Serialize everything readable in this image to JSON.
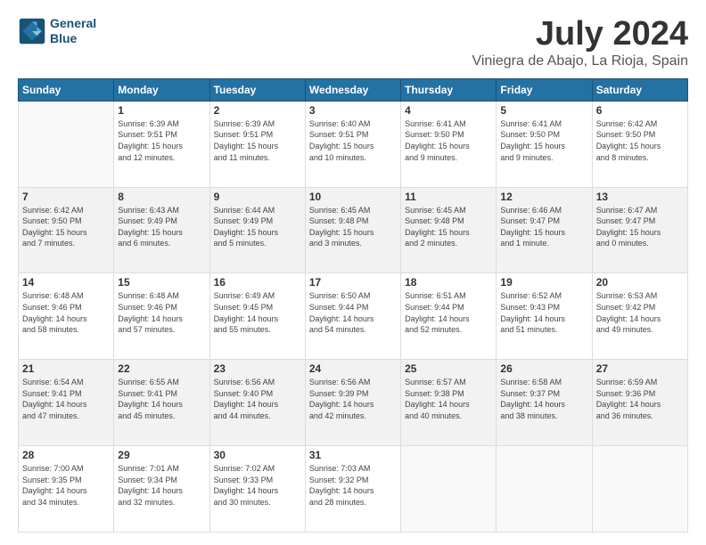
{
  "header": {
    "logo_line1": "General",
    "logo_line2": "Blue",
    "month": "July 2024",
    "location": "Viniegra de Abajo, La Rioja, Spain"
  },
  "weekdays": [
    "Sunday",
    "Monday",
    "Tuesday",
    "Wednesday",
    "Thursday",
    "Friday",
    "Saturday"
  ],
  "weeks": [
    [
      {
        "day": "",
        "info": ""
      },
      {
        "day": "1",
        "info": "Sunrise: 6:39 AM\nSunset: 9:51 PM\nDaylight: 15 hours\nand 12 minutes."
      },
      {
        "day": "2",
        "info": "Sunrise: 6:39 AM\nSunset: 9:51 PM\nDaylight: 15 hours\nand 11 minutes."
      },
      {
        "day": "3",
        "info": "Sunrise: 6:40 AM\nSunset: 9:51 PM\nDaylight: 15 hours\nand 10 minutes."
      },
      {
        "day": "4",
        "info": "Sunrise: 6:41 AM\nSunset: 9:50 PM\nDaylight: 15 hours\nand 9 minutes."
      },
      {
        "day": "5",
        "info": "Sunrise: 6:41 AM\nSunset: 9:50 PM\nDaylight: 15 hours\nand 9 minutes."
      },
      {
        "day": "6",
        "info": "Sunrise: 6:42 AM\nSunset: 9:50 PM\nDaylight: 15 hours\nand 8 minutes."
      }
    ],
    [
      {
        "day": "7",
        "info": "Sunrise: 6:42 AM\nSunset: 9:50 PM\nDaylight: 15 hours\nand 7 minutes."
      },
      {
        "day": "8",
        "info": "Sunrise: 6:43 AM\nSunset: 9:49 PM\nDaylight: 15 hours\nand 6 minutes."
      },
      {
        "day": "9",
        "info": "Sunrise: 6:44 AM\nSunset: 9:49 PM\nDaylight: 15 hours\nand 5 minutes."
      },
      {
        "day": "10",
        "info": "Sunrise: 6:45 AM\nSunset: 9:48 PM\nDaylight: 15 hours\nand 3 minutes."
      },
      {
        "day": "11",
        "info": "Sunrise: 6:45 AM\nSunset: 9:48 PM\nDaylight: 15 hours\nand 2 minutes."
      },
      {
        "day": "12",
        "info": "Sunrise: 6:46 AM\nSunset: 9:47 PM\nDaylight: 15 hours\nand 1 minute."
      },
      {
        "day": "13",
        "info": "Sunrise: 6:47 AM\nSunset: 9:47 PM\nDaylight: 15 hours\nand 0 minutes."
      }
    ],
    [
      {
        "day": "14",
        "info": "Sunrise: 6:48 AM\nSunset: 9:46 PM\nDaylight: 14 hours\nand 58 minutes."
      },
      {
        "day": "15",
        "info": "Sunrise: 6:48 AM\nSunset: 9:46 PM\nDaylight: 14 hours\nand 57 minutes."
      },
      {
        "day": "16",
        "info": "Sunrise: 6:49 AM\nSunset: 9:45 PM\nDaylight: 14 hours\nand 55 minutes."
      },
      {
        "day": "17",
        "info": "Sunrise: 6:50 AM\nSunset: 9:44 PM\nDaylight: 14 hours\nand 54 minutes."
      },
      {
        "day": "18",
        "info": "Sunrise: 6:51 AM\nSunset: 9:44 PM\nDaylight: 14 hours\nand 52 minutes."
      },
      {
        "day": "19",
        "info": "Sunrise: 6:52 AM\nSunset: 9:43 PM\nDaylight: 14 hours\nand 51 minutes."
      },
      {
        "day": "20",
        "info": "Sunrise: 6:53 AM\nSunset: 9:42 PM\nDaylight: 14 hours\nand 49 minutes."
      }
    ],
    [
      {
        "day": "21",
        "info": "Sunrise: 6:54 AM\nSunset: 9:41 PM\nDaylight: 14 hours\nand 47 minutes."
      },
      {
        "day": "22",
        "info": "Sunrise: 6:55 AM\nSunset: 9:41 PM\nDaylight: 14 hours\nand 45 minutes."
      },
      {
        "day": "23",
        "info": "Sunrise: 6:56 AM\nSunset: 9:40 PM\nDaylight: 14 hours\nand 44 minutes."
      },
      {
        "day": "24",
        "info": "Sunrise: 6:56 AM\nSunset: 9:39 PM\nDaylight: 14 hours\nand 42 minutes."
      },
      {
        "day": "25",
        "info": "Sunrise: 6:57 AM\nSunset: 9:38 PM\nDaylight: 14 hours\nand 40 minutes."
      },
      {
        "day": "26",
        "info": "Sunrise: 6:58 AM\nSunset: 9:37 PM\nDaylight: 14 hours\nand 38 minutes."
      },
      {
        "day": "27",
        "info": "Sunrise: 6:59 AM\nSunset: 9:36 PM\nDaylight: 14 hours\nand 36 minutes."
      }
    ],
    [
      {
        "day": "28",
        "info": "Sunrise: 7:00 AM\nSunset: 9:35 PM\nDaylight: 14 hours\nand 34 minutes."
      },
      {
        "day": "29",
        "info": "Sunrise: 7:01 AM\nSunset: 9:34 PM\nDaylight: 14 hours\nand 32 minutes."
      },
      {
        "day": "30",
        "info": "Sunrise: 7:02 AM\nSunset: 9:33 PM\nDaylight: 14 hours\nand 30 minutes."
      },
      {
        "day": "31",
        "info": "Sunrise: 7:03 AM\nSunset: 9:32 PM\nDaylight: 14 hours\nand 28 minutes."
      },
      {
        "day": "",
        "info": ""
      },
      {
        "day": "",
        "info": ""
      },
      {
        "day": "",
        "info": ""
      }
    ]
  ]
}
